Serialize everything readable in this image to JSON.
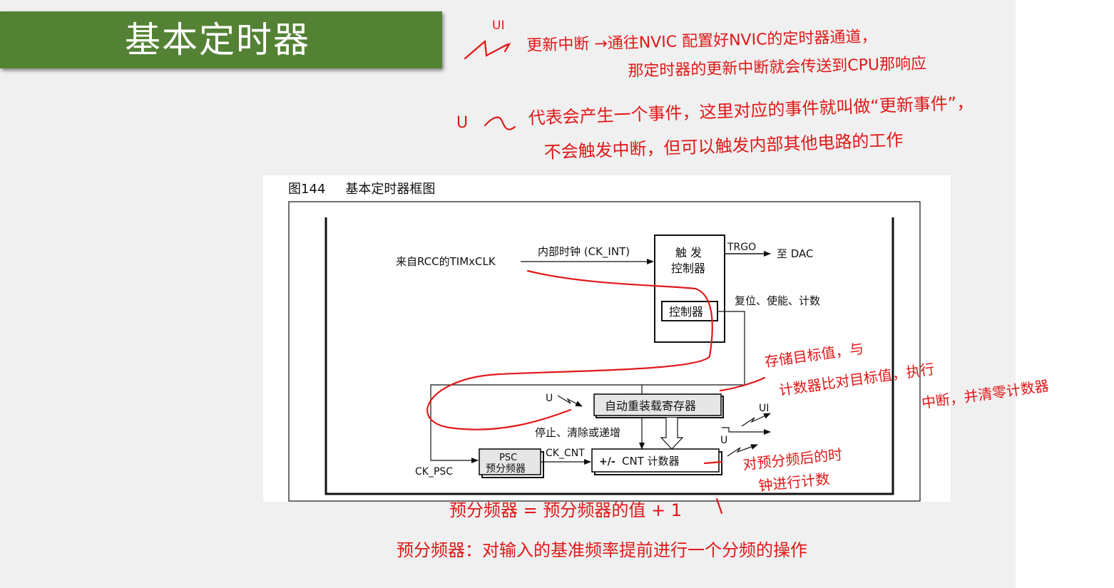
{
  "slide": {
    "title": "基本定时器"
  },
  "figure": {
    "caption_number": "图144",
    "caption_title": "基本定时器框图",
    "labels": {
      "rcc_source": "来自RCC的TIMxCLK",
      "internal_clock": "内部时钟 (CK_INT)",
      "trigger_controller_line1": "触 发",
      "trigger_controller_line2": "控制器",
      "controller": "控制器",
      "trgo": "TRGO",
      "to_dac": "至 DAC",
      "reset_enable_count": "复位、使能、计数",
      "u_left": "U",
      "auto_reload": "自动重装载寄存器",
      "ui": "UI",
      "u_right": "U",
      "stop_clear_increment": "停止、清除或递增",
      "psc_line1": "PSC",
      "psc_line2": "预分频器",
      "ck_cnt": "CK_CNT",
      "cnt_counter": "CNT 计数器",
      "plus_minus": "+/-",
      "ck_psc": "CK_PSC"
    }
  },
  "annotations": {
    "note_ui_label": "UI",
    "note_ui_line1": "更新中断 →通往NVIC 配置好NVIC的定时器通道，",
    "note_ui_line2": "那定时器的更新中断就会传送到CPU那响应",
    "note_u_label": "U",
    "note_u_line1": "代表会产生一个事件，这里对应的事件就叫做“更新事件”，",
    "note_u_line2": "不会触发中断，但可以触发内部其他电路的工作",
    "note_reload_line1": "存储目标值，与",
    "note_reload_line2": "计数器比对目标值，执行",
    "note_reload_line3": "中断，并清零计数器",
    "note_counter_line1": "对预分频后的时",
    "note_counter_line2": "钟进行计数",
    "note_psc_line1": "预分频器 = 预分频器的值 + 1",
    "note_psc_line2": "预分频器：对输入的基准频率提前进行一个分频的操作"
  }
}
